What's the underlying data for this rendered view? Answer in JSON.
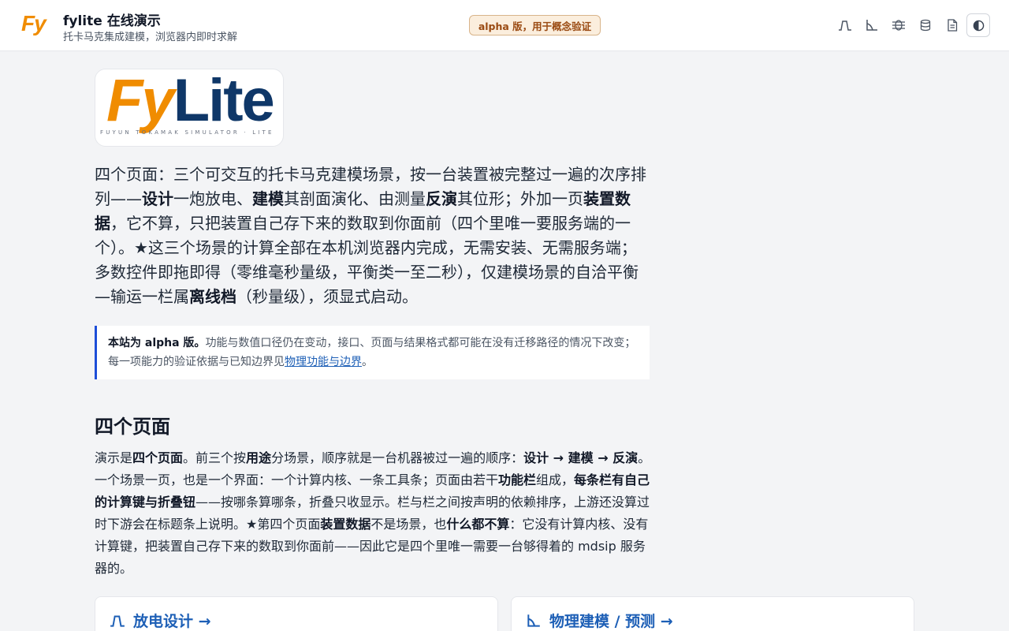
{
  "header": {
    "logo": "Fy",
    "title": "fylite 在线演示",
    "subtitle": "托卡马克集成建模，浏览器内即时求解",
    "badge": "alpha 版，用于概念验证"
  },
  "logo_card": {
    "fy": "Fy",
    "lite": "Lite",
    "tagline": "FUYUN TOKAMAK SIMULATOR · LITE"
  },
  "intro": {
    "t1": "四个页面：三个可交互的托卡马克建模场景，按一台装置被完整过一遍的次序排列——",
    "b1": "设计",
    "t2": "一炮放电、",
    "b2": "建模",
    "t3": "其剖面演化、由测量",
    "b3": "反演",
    "t4": "其位形；外加一页",
    "b4": "装置数据",
    "t5": "，它不算，只把装置自己存下来的数取到你面前（四个里唯一要服务端的一个）。★这三个场景的计算全部在本机浏览器内完成，无需安装、无需服务端；多数控件即拖即得（零维毫秒量级，平衡类一至二秒），仅建模场景的自洽平衡—输运一栏属",
    "b5": "离线档",
    "t6": "（秒量级），须显式启动。"
  },
  "callout": {
    "bold": "本站为 alpha 版。",
    "text": "功能与数值口径仍在变动，接口、页面与结果格式都可能在没有迁移路径的情况下改变；每一项能力的验证依据与已知边界见",
    "link": "物理功能与边界",
    "end": "。"
  },
  "section": {
    "title": "四个页面",
    "t1": "演示是",
    "b1": "四个页面",
    "t2": "。前三个按",
    "b2": "用途",
    "t3": "分场景，顺序就是一台机器被过一遍的顺序：",
    "b3": "设计 → 建模 → 反演",
    "t4": "。一个场景一页，也是一个界面：一个计算内核、一条工具条；页面由若干",
    "b4": "功能栏",
    "t5": "组成，",
    "b5": "每条栏有自己的计算键与折叠钮",
    "t6": "——按哪条算哪条，折叠只收显示。栏与栏之间按声明的依赖排序，上游还没算过时下游会在标题条上说明。★第四个页面",
    "b6": "装置数据",
    "t7": "不是场景，也",
    "b7": "什么都不算",
    "t8": "：它没有计算内核、没有计算键，把装置自己存下来的数取到你面前——因此它是四个里唯一需要一台够得着的 mdsip 服务器的。"
  },
  "cards": [
    {
      "title": "放电设计 →",
      "icon": "pulse-icon"
    },
    {
      "title": "物理建模 / 预测 →",
      "icon": "angle-icon"
    }
  ],
  "colors": {
    "accent_orange": "#f08c00",
    "brand_navy": "#0f3768",
    "link_blue": "#1d5fb6",
    "callout_border": "#1d4ed8"
  }
}
